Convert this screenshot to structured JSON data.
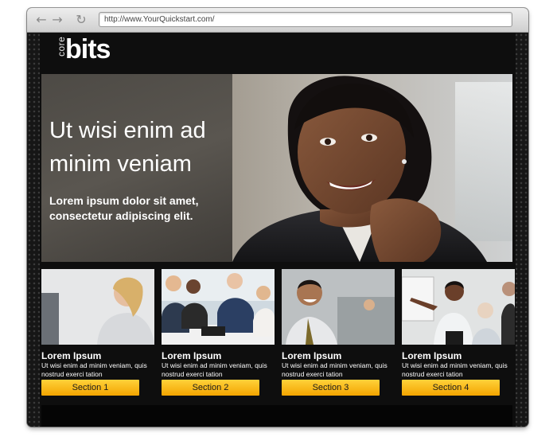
{
  "browser": {
    "url": "http://www.YourQuickstart.com/",
    "back_icon": "arrow-left-icon",
    "forward_icon": "arrow-right-icon",
    "reload_icon": "reload-icon"
  },
  "logo": {
    "prefix": "core",
    "name": "bits"
  },
  "hero": {
    "title": "Ut wisi enim ad minim veniam",
    "subtitle": "Lorem ipsum dolor sit amet, consectetur adipiscing elit."
  },
  "cards": [
    {
      "title": "Lorem Ipsum",
      "text": "Ut wisi enim ad minim veniam, quis nostrud exerci tation",
      "button": "Section 1"
    },
    {
      "title": "Lorem Ipsum",
      "text": "Ut wisi enim ad minim veniam, quis nostrud exerci tation",
      "button": "Section 2"
    },
    {
      "title": "Lorem Ipsum",
      "text": "Ut wisi enim ad minim veniam, quis nostrud exerci tation",
      "button": "Section 3"
    },
    {
      "title": "Lorem Ipsum",
      "text": "Ut wisi enim ad minim veniam, quis nostrud exerci tation",
      "button": "Section 4"
    }
  ],
  "colors": {
    "accent": "#f6b400",
    "background": "#161616",
    "text": "#ffffff"
  }
}
